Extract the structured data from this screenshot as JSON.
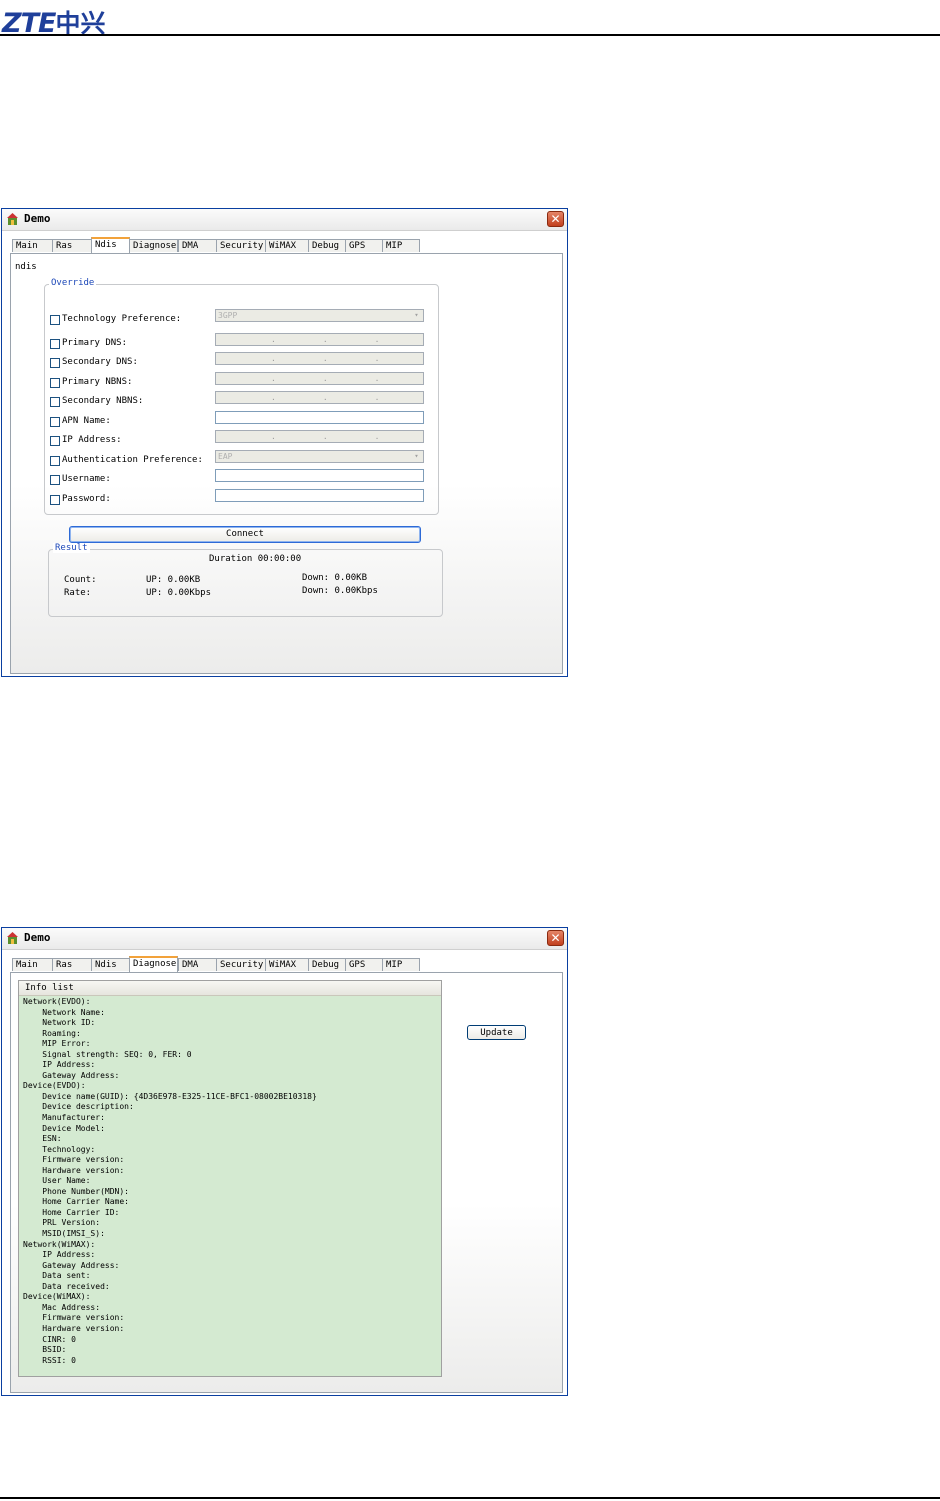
{
  "doc": {
    "logo_latin": "ZTE",
    "logo_cn": "中兴"
  },
  "window1": {
    "title": "Demo",
    "close": "✕",
    "tabs": [
      "Main",
      "Ras",
      "Ndis",
      "Diagnose",
      "DMA",
      "Security",
      "WiMAX",
      "Debug",
      "GPS",
      "MIP"
    ],
    "active_tab": "Ndis",
    "panel_label": "ndis",
    "override": {
      "title": "Override",
      "rows": [
        {
          "label": "Technology Preference:",
          "control": "select",
          "value": "3GPP"
        },
        {
          "label": "Primary DNS:",
          "control": "ip"
        },
        {
          "label": "Secondary DNS:",
          "control": "ip"
        },
        {
          "label": "Primary NBNS:",
          "control": "ip"
        },
        {
          "label": "Secondary NBNS:",
          "control": "ip"
        },
        {
          "label": "APN Name:",
          "control": "text"
        },
        {
          "label": "IP Address:",
          "control": "ip"
        },
        {
          "label": "Authentication Preference:",
          "control": "select",
          "value": "EAP"
        },
        {
          "label": "Username:",
          "control": "text"
        },
        {
          "label": "Password:",
          "control": "text"
        }
      ]
    },
    "connect_label": "Connect",
    "result": {
      "title": "Result",
      "duration": "Duration 00:00:00",
      "count_label": "Count:",
      "rate_label": "Rate:",
      "count_up": "UP: 0.00KB",
      "count_down": "Down: 0.00KB",
      "rate_up": "UP: 0.00Kbps",
      "rate_down": "Down: 0.00Kbps"
    }
  },
  "window2": {
    "title": "Demo",
    "close": "✕",
    "tabs": [
      "Main",
      "Ras",
      "Ndis",
      "Diagnose",
      "DMA",
      "Security",
      "WiMAX",
      "Debug",
      "GPS",
      "MIP"
    ],
    "active_tab": "Diagnose",
    "info_title": "Info list",
    "update_label": "Update",
    "info_lines": [
      "Network(EVDO):",
      "    Network Name:",
      "    Network ID:",
      "    Roaming:",
      "    MIP Error:",
      "    Signal strength: SEQ: 0, FER: 0",
      "    IP Address:",
      "    Gateway Address:",
      "Device(EVDO):",
      "    Device name(GUID): {4D36E978-E325-11CE-BFC1-08002BE10318}",
      "    Device description:",
      "    Manufacturer:",
      "    Device Model:",
      "    ESN:",
      "    Technology:",
      "    Firmware version:",
      "    Hardware version:",
      "    User Name:",
      "    Phone Number(MDN):",
      "    Home Carrier Name:",
      "    Home Carrier ID:",
      "    PRL Version:",
      "    MSID(IMSI_S):",
      "Network(WiMAX):",
      "    IP Address:",
      "    Gateway Address:",
      "    Data sent:",
      "    Data received:",
      "Device(WiMAX):",
      "    Mac Address:",
      "    Firmware version:",
      "    Hardware version:",
      "    CINR: 0",
      "    BSID:",
      "    RSSI: 0"
    ]
  }
}
